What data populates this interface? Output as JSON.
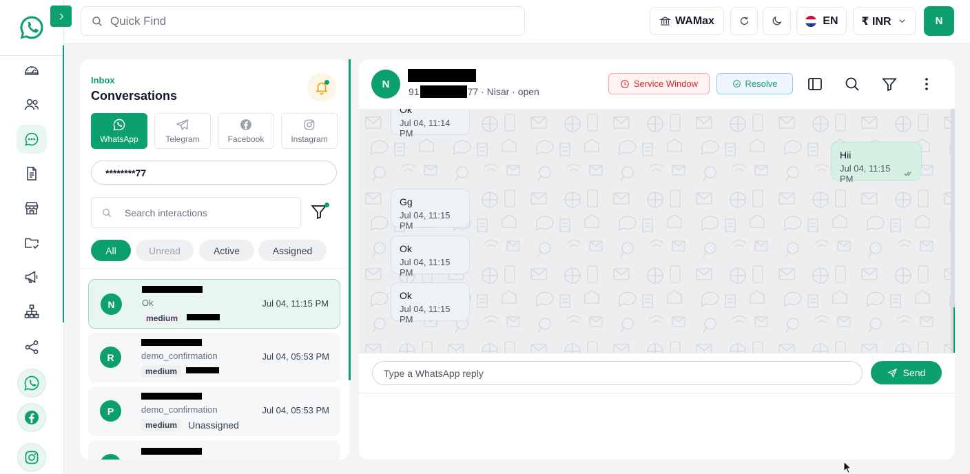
{
  "theme": {
    "accent": "#0e9f6e",
    "danger": "#dc2626",
    "accent_soft": "#e7f6ef"
  },
  "rail": {
    "logo": "whatsapp-logo-icon",
    "items": [
      {
        "icon": "dashboard-icon"
      },
      {
        "icon": "contacts-icon"
      },
      {
        "icon": "chat-icon",
        "active": true
      },
      {
        "icon": "templates-icon"
      },
      {
        "icon": "store-icon"
      },
      {
        "icon": "folder-check-icon"
      },
      {
        "icon": "megaphone-icon"
      },
      {
        "icon": "org-chart-icon"
      },
      {
        "icon": "share-icon"
      }
    ],
    "socials": [
      "whatsapp-icon",
      "facebook-icon",
      "instagram-icon"
    ]
  },
  "topbar": {
    "search_placeholder": "Quick Find",
    "workspace": "WAMax",
    "language": "EN",
    "currency": "₹ INR",
    "avatar_initial": "N"
  },
  "conversations": {
    "kicker": "Inbox",
    "title": "Conversations",
    "channels": [
      {
        "label": "WhatsApp",
        "active": true
      },
      {
        "label": "Telegram"
      },
      {
        "label": "Facebook"
      },
      {
        "label": "Instagram"
      }
    ],
    "phone_filter": "********77",
    "search_placeholder": "Search interactions",
    "filters": [
      "All",
      "Unread",
      "Active",
      "Assigned"
    ],
    "rows": [
      {
        "initial": "N",
        "preview": "Ok",
        "priority": "medium",
        "assignee": "",
        "time": "Jul 04, 11:15 PM"
      },
      {
        "initial": "R",
        "preview": "demo_confirmation",
        "priority": "medium",
        "assignee": "",
        "time": "Jul 04, 05:53 PM"
      },
      {
        "initial": "P",
        "preview": "demo_confirmation",
        "priority": "medium",
        "assignee": "Unassigned",
        "time": "Jul 04, 05:53 PM"
      }
    ]
  },
  "chat": {
    "avatar_initial": "N",
    "sub_prefix": "91",
    "sub_suffix": "77 · Nisar · open",
    "service_window": "Service Window",
    "resolve": "Resolve",
    "messages": [
      {
        "text": "Ok",
        "time": "Jul 04, 11:14 PM",
        "direction": "in"
      },
      {
        "text": "Hii",
        "time": "Jul 04, 11:15 PM",
        "direction": "out"
      },
      {
        "text": "Gg",
        "time": "Jul 04, 11:15 PM",
        "direction": "in"
      },
      {
        "text": "Ok",
        "time": "Jul 04, 11:15 PM",
        "direction": "in"
      },
      {
        "text": "Ok",
        "time": "Jul 04, 11:15 PM",
        "direction": "in"
      }
    ],
    "reply_placeholder": "Type a WhatsApp reply",
    "send": "Send"
  }
}
